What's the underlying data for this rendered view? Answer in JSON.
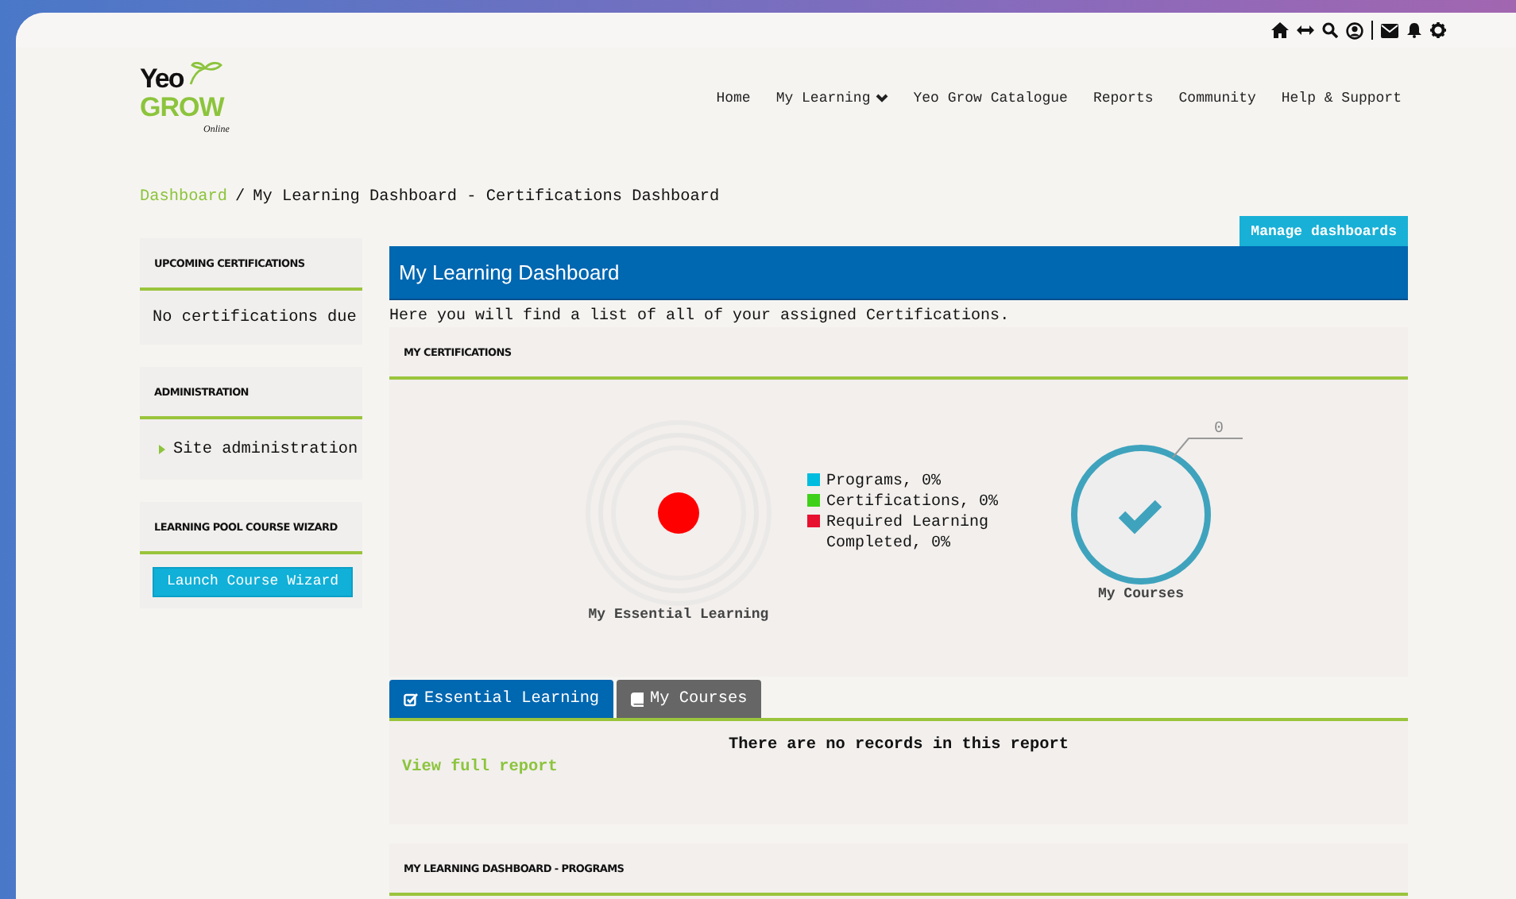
{
  "logo": {
    "line_1": "Yeo",
    "line_2": "GROW",
    "line_3": "Online"
  },
  "nav": [
    {
      "label": "Home",
      "has_menu": false
    },
    {
      "label": "My Learning",
      "has_menu": true
    },
    {
      "label": "Yeo Grow Catalogue",
      "has_menu": false
    },
    {
      "label": "Reports",
      "has_menu": false
    },
    {
      "label": "Community",
      "has_menu": false
    },
    {
      "label": "Help & Support",
      "has_menu": false
    }
  ],
  "breadcrumb": {
    "separator": "/",
    "items": [
      {
        "label": "Dashboard",
        "link": true
      },
      {
        "label": "My Learning Dashboard - Certifications Dashboard",
        "link": false
      }
    ]
  },
  "sidebar": {
    "blocks": [
      {
        "title": "UPCOMING CERTIFICATIONS",
        "kind": "text",
        "text": "No certifications due"
      },
      {
        "title": "ADMINISTRATION",
        "kind": "link",
        "text": "Site administration"
      },
      {
        "title": "LEARNING POOL COURSE WIZARD",
        "kind": "button",
        "text": "Launch Course Wizard"
      }
    ]
  },
  "main": {
    "manage_button": "Manage dashboards",
    "title": "My Learning Dashboard",
    "description": "Here you will find a list of all of your assigned Certifications.",
    "certifications": {
      "title": "MY CERTIFICATIONS",
      "essential_label": "My Essential Learning",
      "legend": [
        {
          "label": "Programs, 0%",
          "color": "#00bcdf"
        },
        {
          "label": "Certifications, 0%",
          "color": "#3fd11a"
        },
        {
          "label": "Required Learning Completed, 0%",
          "color": "#e8102f"
        }
      ],
      "courses_label": "My Courses",
      "courses_count": "0"
    },
    "tabs": [
      {
        "label": "Essential Learning",
        "kind": "checklist",
        "selected": true
      },
      {
        "label": "My Courses",
        "kind": "book",
        "selected": false
      }
    ],
    "report": {
      "message": "There are no records in this report",
      "link": "View full report"
    },
    "programs": {
      "title": "MY LEARNING DASHBOARD - PROGRAMS"
    }
  }
}
